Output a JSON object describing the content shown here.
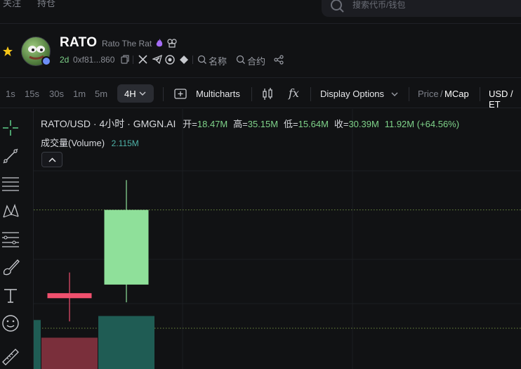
{
  "nav": {
    "tab_follow": "关注",
    "tab_holdings": "持仓"
  },
  "search": {
    "placeholder": "搜索代币/钱包"
  },
  "token": {
    "symbol": "RATO",
    "name": "Rato The Rat",
    "age": "2d",
    "address": "0xf81...860",
    "name_search_label": "名称",
    "contract_search_label": "合约"
  },
  "toolbar": {
    "timeframes": [
      "1s",
      "15s",
      "30s",
      "1m",
      "5m"
    ],
    "active_timeframe": "4H",
    "multicharts": "Multicharts",
    "fx": "fx",
    "display_options": "Display Options",
    "price": "Price",
    "slash": "/",
    "mcap": "MCap",
    "currency": "USD / ET"
  },
  "legend": {
    "title": "RATO/USD · 4小时 · GMGN.AI",
    "open_label": "开=",
    "open": "18.47M",
    "high_label": "高=",
    "high": "35.15M",
    "low_label": "低=",
    "low": "15.64M",
    "close_label": "收=",
    "close": "30.39M",
    "change": "11.92M (+64.56%)",
    "volume_label": "成交量(Volume)",
    "volume": "2.115M"
  },
  "colors": {
    "up": "#8fe09a",
    "down": "#f0506e",
    "vol_up": "#1f5c54",
    "vol_down": "#7a2f3b",
    "accent_green": "#7fd38a",
    "background": "#111214"
  },
  "chart_data": {
    "type": "candlestick",
    "interval": "4h",
    "unit": "Market cap (USD)",
    "candles": [
      {
        "open": 17.1,
        "high": 20.4,
        "low": 12.6,
        "close": 16.3,
        "volume": 1.25
      },
      {
        "open": 18.47,
        "high": 35.15,
        "low": 15.64,
        "close": 30.39,
        "volume": 2.115
      }
    ],
    "reference_lines": [
      30.39,
      11.5
    ]
  }
}
